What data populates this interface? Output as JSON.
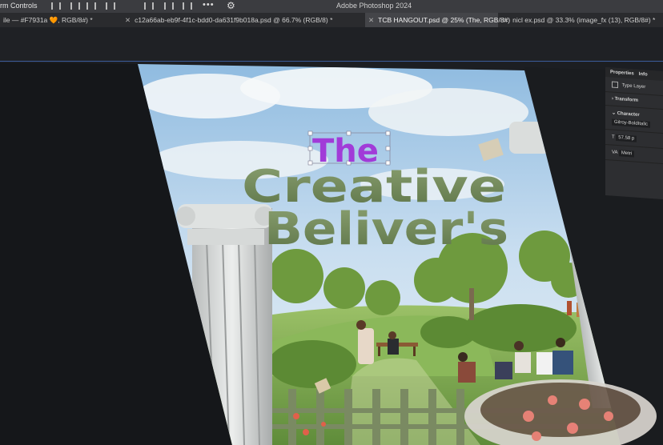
{
  "app": {
    "name": "Adobe Photoshop 2024",
    "options_title": "rm Controls"
  },
  "tabs": [
    {
      "label": "ile — #F7931a 🧡, RGB/8#) *"
    },
    {
      "label": "c12a66ab-eb9f-4f1c-bdd0-da631f9b018a.psd @ 66.7% (RGB/8) *"
    },
    {
      "label": "TCB HANGOUT.psd @ 25% (The, RGB/8#)"
    },
    {
      "label": "nicl ex.psd @ 33.3% (image_fx (13), RGB/8#) *"
    }
  ],
  "artwork": {
    "title_the": "The",
    "title_line1": "Creative",
    "title_line2": "Beliver's"
  },
  "properties": {
    "tab1": "Properties",
    "tab2": "Info",
    "layer_type": "Type Layer",
    "transform": "Transform",
    "character": "Character",
    "font": "Gilroy-BoldItalic",
    "size": "57.58 p",
    "metrics": "Metri"
  },
  "colors": {
    "purple": "#a13bd8",
    "green_text": "#6f8a55",
    "sky": "#9fc6e6"
  }
}
